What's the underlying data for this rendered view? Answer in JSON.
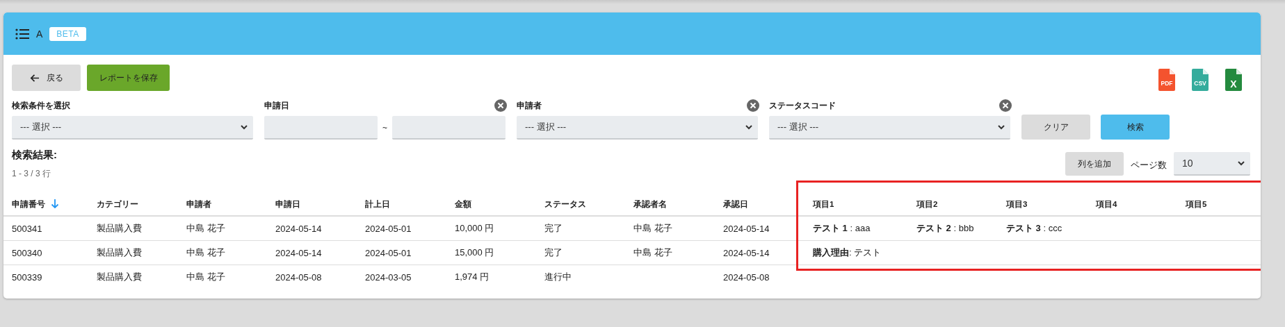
{
  "header": {
    "title": "A",
    "badge": "BETA"
  },
  "actions": {
    "back": "戻る",
    "save": "レポートを保存"
  },
  "exports": [
    {
      "kind": "pdf",
      "label": "PDF"
    },
    {
      "kind": "csv",
      "label": "CSV"
    },
    {
      "kind": "excel",
      "label": "X"
    }
  ],
  "filters": [
    {
      "kind": "select",
      "label": "検索条件を選択",
      "value": "--- 選択 ---",
      "clearable": false
    },
    {
      "kind": "daterange",
      "label": "申請日",
      "separator": "~",
      "clearable": true
    },
    {
      "kind": "select",
      "label": "申請者",
      "value": "--- 選択 ---",
      "clearable": true
    },
    {
      "kind": "select",
      "label": "ステータスコード",
      "value": "--- 選択 ---",
      "clearable": true
    }
  ],
  "filter_buttons": {
    "clear": "クリア",
    "search": "検索"
  },
  "results": {
    "title": "検索結果:",
    "count": "1 - 3 / 3 行",
    "add_column": "列を追加",
    "page_size_label": "ページ数",
    "page_size": "10"
  },
  "table": {
    "columns": [
      {
        "label": "申請番号",
        "sorted": true
      },
      {
        "label": "カテゴリー",
        "sorted": false
      },
      {
        "label": "申請者",
        "sorted": false
      },
      {
        "label": "申請日",
        "sorted": false
      },
      {
        "label": "計上日",
        "sorted": false
      },
      {
        "label": "金額",
        "sorted": false
      },
      {
        "label": "ステータス",
        "sorted": false
      },
      {
        "label": "承認者名",
        "sorted": false
      },
      {
        "label": "承認日",
        "sorted": false
      }
    ],
    "framed_columns": [
      {
        "label": "項目1",
        "sorted": false
      },
      {
        "label": "項目2",
        "sorted": false
      },
      {
        "label": "項目3",
        "sorted": false
      },
      {
        "label": "項目4",
        "sorted": false
      },
      {
        "label": "項目5",
        "sorted": false
      }
    ],
    "rows": [
      {
        "cells": [
          "500341",
          "製品購入費",
          "中島 花子",
          "2024-05-14",
          "2024-05-01",
          "10,000 円",
          "完了",
          "中島 花子",
          "2024-05-14"
        ],
        "framed_cells": [
          "**テスト 1** : aaa",
          "**テスト 2** : bbb",
          "**テスト 3** : ccc",
          "",
          ""
        ]
      },
      {
        "cells": [
          "500340",
          "製品購入費",
          "中島 花子",
          "2024-05-14",
          "2024-05-01",
          "15,000 円",
          "完了",
          "中島 花子",
          "2024-05-14"
        ],
        "framed_cells": [
          "**購入理由**: テスト",
          "",
          "",
          "",
          ""
        ]
      },
      {
        "cells": [
          "500339",
          "製品購入費",
          "中島 花子",
          "2024-05-08",
          "2024-03-05",
          "1,974 円",
          "進行中",
          "",
          "2024-05-08"
        ],
        "framed_cells": [
          "",
          "",
          "",
          "",
          ""
        ]
      }
    ]
  }
}
